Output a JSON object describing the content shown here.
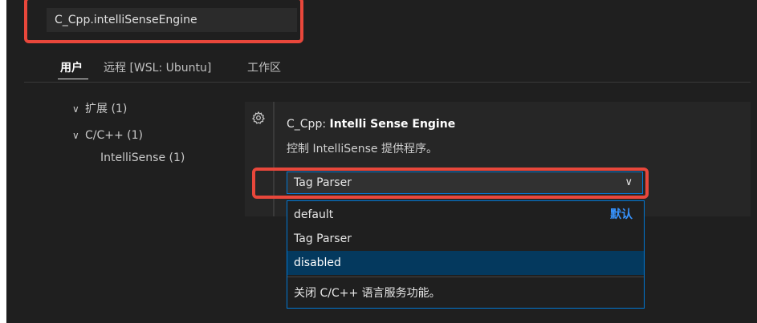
{
  "search": {
    "value": "C_Cpp.intelliSenseEngine"
  },
  "tabs": [
    {
      "label": "用户",
      "active": true
    },
    {
      "label": "远程 [WSL: Ubuntu]",
      "active": false
    },
    {
      "label": "工作区",
      "active": false
    }
  ],
  "toc": [
    {
      "label": "扩展 (1)",
      "level": 0,
      "expanded": true
    },
    {
      "label": "C/C++ (1)",
      "level": 1,
      "expanded": true
    },
    {
      "label": "IntelliSense (1)",
      "level": 2,
      "expanded": false
    }
  ],
  "setting": {
    "prefix": "C_Cpp: ",
    "name": "Intelli Sense Engine",
    "description": "控制 IntelliSense 提供程序。",
    "icon": "gear-icon",
    "current_value": "Tag Parser"
  },
  "dropdown": {
    "options": [
      {
        "label": "default",
        "badge": "默认",
        "selected": false
      },
      {
        "label": "Tag Parser",
        "badge": "",
        "selected": false
      },
      {
        "label": "disabled",
        "badge": "",
        "selected": true
      }
    ],
    "description": "关闭 C/C++ 语言服务功能。"
  },
  "colors": {
    "highlight": "#e8473b",
    "accent": "#0078d4",
    "selected_bg": "#04395e",
    "badge": "#3794ff"
  }
}
